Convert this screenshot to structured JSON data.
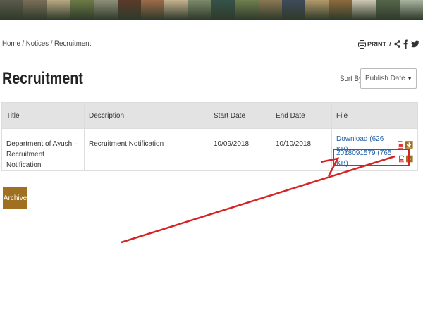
{
  "banner": {
    "tiles": [
      "#5b5a4c",
      "#7a6f58",
      "#b9a882",
      "#6c7a46",
      "#8e8e7a",
      "#5b3a2a",
      "#9c6b4a",
      "#c6b28f",
      "#7b8a6a",
      "#35534a",
      "#6f7f4e",
      "#8a7752",
      "#3e4b5a",
      "#b39a6a",
      "#8c6a3d",
      "#cfc7b6",
      "#55664b",
      "#a8b3a0"
    ]
  },
  "breadcrumb": {
    "items": [
      "Home",
      "Notices",
      "Recruitment"
    ],
    "separator": "/"
  },
  "tools": {
    "print_label": "PRINT",
    "separator": "/"
  },
  "page": {
    "title": "Recruitment"
  },
  "sort": {
    "label": "Sort By:",
    "selected": "Publish Date"
  },
  "table": {
    "headers": [
      "Title",
      "Description",
      "Start Date",
      "End Date",
      "File"
    ],
    "rows": [
      {
        "title_line1": "Department of Ayush –",
        "title_line2": "Recruitment Notification",
        "description": "Recruitment Notification",
        "start_date": "10/09/2018",
        "end_date": "10/10/2018",
        "files": [
          "Download (626 KB)",
          "2018091579 (765 KB)"
        ]
      }
    ]
  },
  "archive": {
    "label": "Archive"
  },
  "colors": {
    "accent_button": "#a07020",
    "link": "#2561a8",
    "annotation": "#d42424"
  }
}
